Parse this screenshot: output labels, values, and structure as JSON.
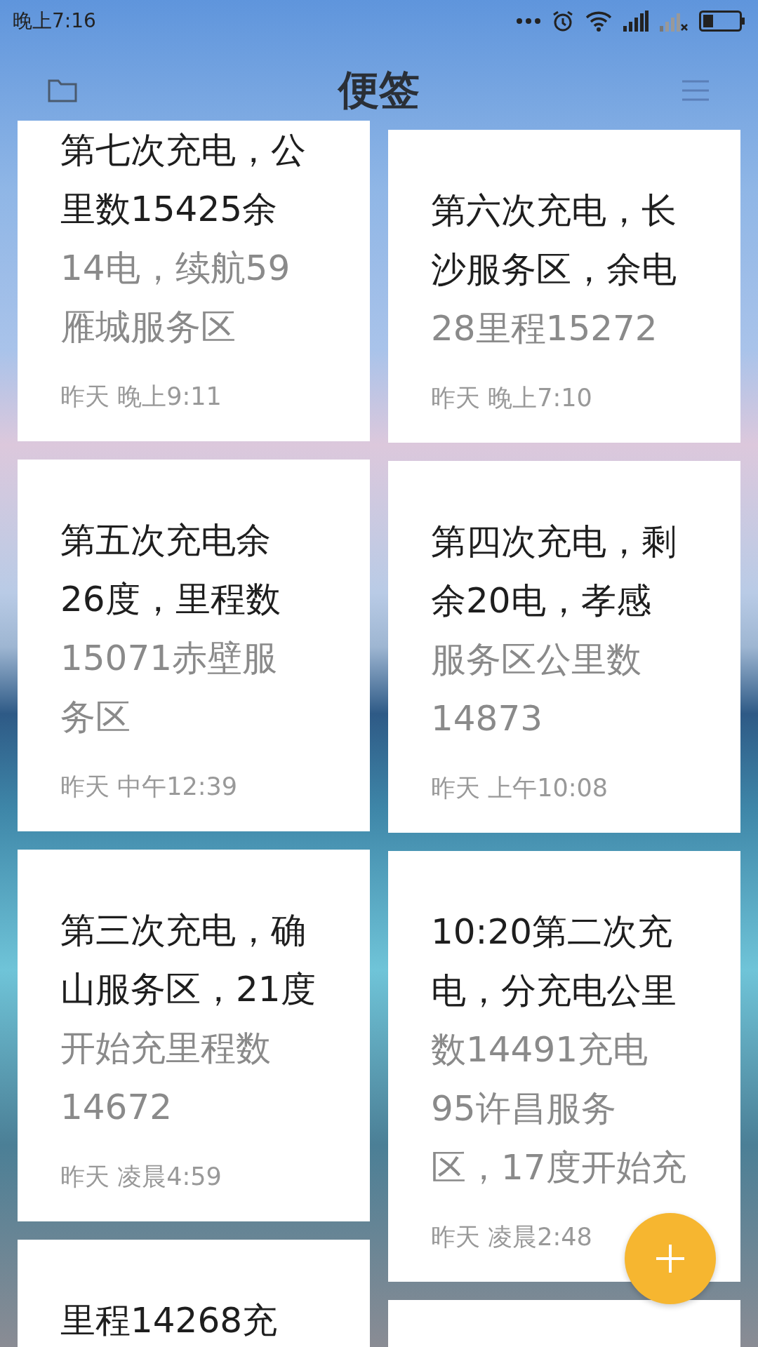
{
  "status_bar": {
    "time": "晚上7:16"
  },
  "header": {
    "title": "便签"
  },
  "columns": [
    [
      {
        "kind": "note",
        "title_lines": [
          "第七次充电，公",
          "里数15425余"
        ],
        "body_lines": [
          "14电，续航59",
          "雁城服务区"
        ],
        "date": "昨天 晚上9:11"
      },
      {
        "kind": "note",
        "title_lines": [
          "第五次充电余",
          "26度，里程数"
        ],
        "body_lines": [
          "15071赤壁服",
          "务区"
        ],
        "date": "昨天 中午12:39"
      },
      {
        "kind": "note",
        "title_lines": [
          "第三次充电，确",
          "山服务区，21度"
        ],
        "body_lines": [
          "开始充里程数",
          "14672"
        ],
        "date": "昨天 凌晨4:59"
      },
      {
        "kind": "note",
        "title_lines": [
          "里程14268充"
        ]
      }
    ],
    [
      {
        "kind": "note",
        "title_lines": [
          "第六次充电，长",
          "沙服务区，余电"
        ],
        "body_lines": [
          "28里程15272"
        ],
        "date": "昨天 晚上7:10"
      },
      {
        "kind": "note",
        "title_lines": [
          "第四次充电，剩",
          "余20电，孝感"
        ],
        "body_lines": [
          "服务区公里数",
          "14873"
        ],
        "date": "昨天 上午10:08"
      },
      {
        "kind": "note",
        "title_lines": [
          "10:20第二次充",
          "电，分充电公里"
        ],
        "body_lines": [
          "数14491充电",
          "95许昌服务",
          "区，17度开始充"
        ],
        "date": "昨天 凌晨2:48"
      },
      {
        "kind": "note"
      }
    ]
  ]
}
